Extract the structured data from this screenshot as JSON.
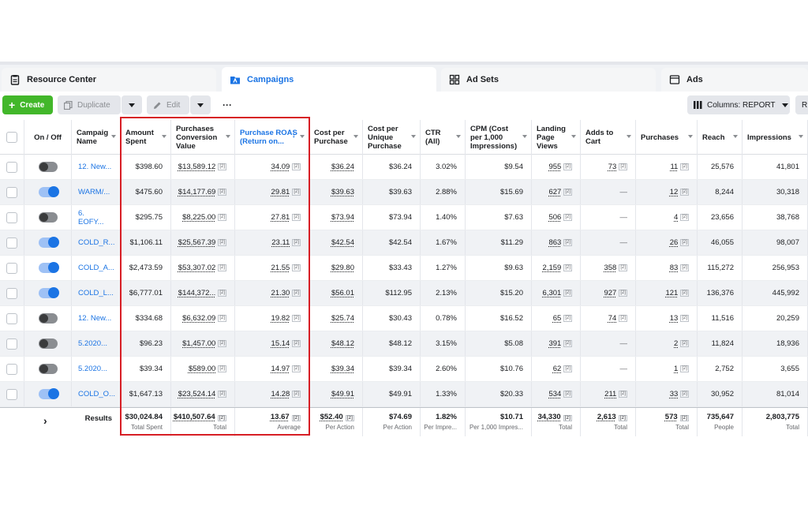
{
  "tabs": [
    {
      "label": "Resource Center",
      "icon": "clipboard-icon"
    },
    {
      "label": "Campaigns",
      "icon": "folder-icon"
    },
    {
      "label": "Ad Sets",
      "icon": "grid-icon"
    },
    {
      "label": "Ads",
      "icon": "ad-window-icon"
    }
  ],
  "toolbar": {
    "create_label": "Create",
    "duplicate_label": "Duplicate",
    "edit_label": "Edit",
    "more_label": "···",
    "columns_label": "Columns: REPORT",
    "r_label": "R"
  },
  "columns": [
    {
      "label": "On / Off"
    },
    {
      "label": "Campaig Name"
    },
    {
      "label": "Amount Spent"
    },
    {
      "label": "Purchases Conversion Value"
    },
    {
      "label": "Purchase ROAS (Return on..."
    },
    {
      "label": "Cost per Purchase"
    },
    {
      "label": "Cost per Unique Purchase"
    },
    {
      "label": "CTR (All)"
    },
    {
      "label": "CPM (Cost per 1,000 Impressions)"
    },
    {
      "label": "Landing Page Views"
    },
    {
      "label": "Adds to Cart"
    },
    {
      "label": "Purchases"
    },
    {
      "label": "Reach"
    },
    {
      "label": "Impressions"
    }
  ],
  "rows": [
    {
      "on": false,
      "name": "12. New...",
      "spent": "$398.60",
      "conv": "$13,589.12",
      "roas": "34.09",
      "cpp": "$36.24",
      "cpup": "$36.24",
      "ctr": "3.02%",
      "cpm": "$9.54",
      "lpv": "955",
      "atc": "73",
      "purch": "11",
      "reach": "25,576",
      "impr": "41,801"
    },
    {
      "on": true,
      "name": "WARM/...",
      "spent": "$475.60",
      "conv": "$14,177.69",
      "roas": "29.81",
      "cpp": "$39.63",
      "cpup": "$39.63",
      "ctr": "2.88%",
      "cpm": "$15.69",
      "lpv": "627",
      "atc": "—",
      "purch": "12",
      "reach": "8,244",
      "impr": "30,318"
    },
    {
      "on": false,
      "name": "6. EOFY...",
      "spent": "$295.75",
      "conv": "$8,225.00",
      "roas": "27.81",
      "cpp": "$73.94",
      "cpup": "$73.94",
      "ctr": "1.40%",
      "cpm": "$7.63",
      "lpv": "506",
      "atc": "—",
      "purch": "4",
      "reach": "23,656",
      "impr": "38,768"
    },
    {
      "on": true,
      "name": "COLD_R...",
      "spent": "$1,106.11",
      "conv": "$25,567.39",
      "roas": "23.11",
      "cpp": "$42.54",
      "cpup": "$42.54",
      "ctr": "1.67%",
      "cpm": "$11.29",
      "lpv": "863",
      "atc": "—",
      "purch": "26",
      "reach": "46,055",
      "impr": "98,007"
    },
    {
      "on": true,
      "name": "COLD_A...",
      "spent": "$2,473.59",
      "conv": "$53,307.02",
      "roas": "21.55",
      "cpp": "$29.80",
      "cpup": "$33.43",
      "ctr": "1.27%",
      "cpm": "$9.63",
      "lpv": "2,159",
      "atc": "358",
      "purch": "83",
      "reach": "115,272",
      "impr": "256,953"
    },
    {
      "on": true,
      "name": "COLD_L...",
      "spent": "$6,777.01",
      "conv": "$144,372...",
      "roas": "21.30",
      "cpp": "$56.01",
      "cpup": "$112.95",
      "ctr": "2.13%",
      "cpm": "$15.20",
      "lpv": "6,301",
      "atc": "927",
      "purch": "121",
      "reach": "136,376",
      "impr": "445,992"
    },
    {
      "on": false,
      "name": "12. New...",
      "spent": "$334.68",
      "conv": "$6,632.09",
      "roas": "19.82",
      "cpp": "$25.74",
      "cpup": "$30.43",
      "ctr": "0.78%",
      "cpm": "$16.52",
      "lpv": "65",
      "atc": "74",
      "purch": "13",
      "reach": "11,516",
      "impr": "20,259"
    },
    {
      "on": false,
      "name": "5.2020...",
      "spent": "$96.23",
      "conv": "$1,457.00",
      "roas": "15.14",
      "cpp": "$48.12",
      "cpup": "$48.12",
      "ctr": "3.15%",
      "cpm": "$5.08",
      "lpv": "391",
      "atc": "—",
      "purch": "2",
      "reach": "11,824",
      "impr": "18,936"
    },
    {
      "on": false,
      "name": "5.2020...",
      "spent": "$39.34",
      "conv": "$589.00",
      "roas": "14.97",
      "cpp": "$39.34",
      "cpup": "$39.34",
      "ctr": "2.60%",
      "cpm": "$10.76",
      "lpv": "62",
      "atc": "—",
      "purch": "1",
      "reach": "2,752",
      "impr": "3,655"
    },
    {
      "on": true,
      "name": "COLD_O...",
      "spent": "$1,647.13",
      "conv": "$23,524.14",
      "roas": "14.28",
      "cpp": "$49.91",
      "cpup": "$49.91",
      "ctr": "1.33%",
      "cpm": "$20.33",
      "lpv": "534",
      "atc": "211",
      "purch": "33",
      "reach": "30,952",
      "impr": "81,014"
    }
  ],
  "results": {
    "label": "Results",
    "spent": "$30,024.84",
    "spent_sub": "Total Spent",
    "conv": "$410,507.64",
    "conv_sub": "Total",
    "roas": "13.67",
    "roas_sub": "Average",
    "cpp": "$52.40",
    "cpp_sub": "Per Action",
    "cpup": "$74.69",
    "cpup_sub": "Per Action",
    "ctr": "1.82%",
    "ctr_sub": "Per Impre...",
    "cpm": "$10.71",
    "cpm_sub": "Per 1,000 Impres...",
    "lpv": "34,330",
    "lpv_sub": "Total",
    "atc": "2,613",
    "atc_sub": "Total",
    "purch": "573",
    "purch_sub": "Total",
    "reach": "735,647",
    "reach_sub": "People",
    "impr": "2,803,775",
    "impr_sub": "Total"
  },
  "superscript": "[2]",
  "colors": {
    "accent": "#1b74e4",
    "create": "#42b72a",
    "highlight": "#d71e25"
  }
}
